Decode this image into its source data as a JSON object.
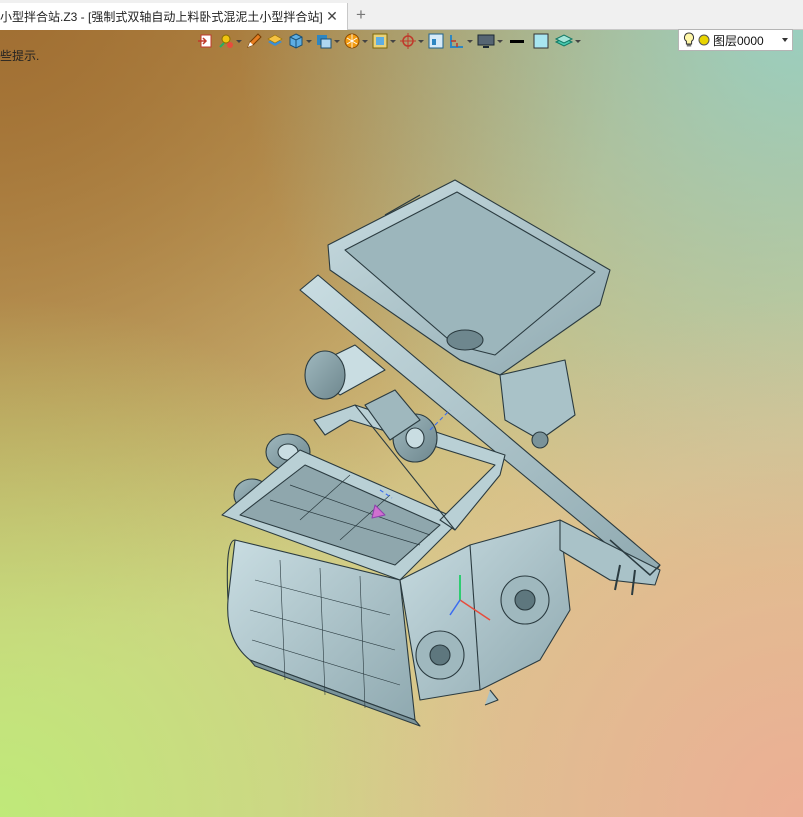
{
  "tab": {
    "title": "小型拌合站.Z3 - [强制式双轴自动上料卧式混泥土小型拌合站]",
    "close_symbol": "✕",
    "add_symbol": "+"
  },
  "toolbar": {
    "icons": [
      "exit-sketch-icon",
      "snap-point-icon",
      "pen-icon",
      "layer-box-icon",
      "cube-view-icon",
      "display-mode-icon",
      "render-sphere-icon",
      "section-view-icon",
      "axis-triad-icon",
      "frame-icon",
      "ruler-icon",
      "monitor-icon",
      "line-color-icon",
      "fill-color-icon",
      "layer-stack-icon"
    ],
    "layer": {
      "value": "图层0000"
    }
  },
  "hint": {
    "text": "些提示."
  },
  "colors": {
    "model_steel": "#a9c2c8",
    "model_edge": "#2b3b40"
  }
}
